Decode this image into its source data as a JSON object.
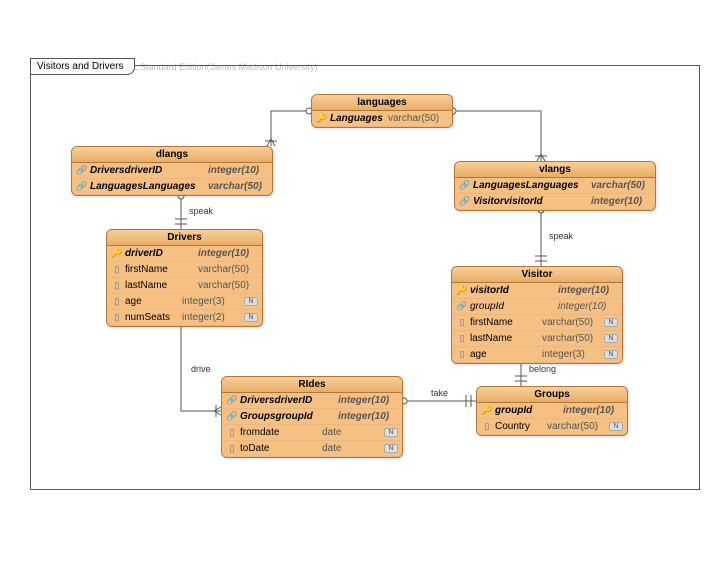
{
  "watermark": "Visual Paradigm for UML Standard Edition(James Madison University)",
  "frame_title": "Visitors and Drivers",
  "entities": {
    "languages": {
      "title": "languages",
      "cols": [
        {
          "icon": "pk",
          "name": "Languages",
          "type": "varchar(50)",
          "nullable": false
        }
      ]
    },
    "dlangs": {
      "title": "dlangs",
      "cols": [
        {
          "icon": "fk",
          "name": "DriversdriverID",
          "type": "integer(10)",
          "nullable": false,
          "bold": true
        },
        {
          "icon": "fk",
          "name": "LanguagesLanguages",
          "type": "varchar(50)",
          "nullable": false,
          "bold": true
        }
      ]
    },
    "vlangs": {
      "title": "vlangs",
      "cols": [
        {
          "icon": "fk",
          "name": "LanguagesLanguages",
          "type": "varchar(50)",
          "nullable": false,
          "bold": true
        },
        {
          "icon": "fk",
          "name": "VisitorvisitorId",
          "type": "integer(10)",
          "nullable": false,
          "bold": true
        }
      ]
    },
    "drivers": {
      "title": "Drivers",
      "cols": [
        {
          "icon": "pk",
          "name": "driverID",
          "type": "integer(10)",
          "nullable": false,
          "bold": true
        },
        {
          "icon": "col",
          "name": "firstName",
          "type": "varchar(50)",
          "nullable": false
        },
        {
          "icon": "col",
          "name": "lastName",
          "type": "varchar(50)",
          "nullable": false
        },
        {
          "icon": "col",
          "name": "age",
          "type": "integer(3)",
          "nullable": true
        },
        {
          "icon": "col",
          "name": "numSeats",
          "type": "integer(2)",
          "nullable": true
        }
      ]
    },
    "visitor": {
      "title": "Visitor",
      "cols": [
        {
          "icon": "pk",
          "name": "visitorId",
          "type": "integer(10)",
          "nullable": false,
          "bold": true
        },
        {
          "icon": "fk",
          "name": "groupId",
          "type": "integer(10)",
          "nullable": false,
          "italic": true
        },
        {
          "icon": "col",
          "name": "firstName",
          "type": "varchar(50)",
          "nullable": true
        },
        {
          "icon": "col",
          "name": "lastName",
          "type": "varchar(50)",
          "nullable": true
        },
        {
          "icon": "col",
          "name": "age",
          "type": "integer(3)",
          "nullable": true
        }
      ]
    },
    "rides": {
      "title": "RIdes",
      "cols": [
        {
          "icon": "fk",
          "name": "DriversdriverID",
          "type": "integer(10)",
          "nullable": false,
          "bold": true
        },
        {
          "icon": "fk",
          "name": "GroupsgroupId",
          "type": "integer(10)",
          "nullable": false,
          "bold": true
        },
        {
          "icon": "col",
          "name": "fromdate",
          "type": "date",
          "nullable": true
        },
        {
          "icon": "col",
          "name": "toDate",
          "type": "date",
          "nullable": true
        }
      ]
    },
    "groups": {
      "title": "Groups",
      "cols": [
        {
          "icon": "pk",
          "name": "groupId",
          "type": "integer(10)",
          "nullable": false,
          "bold": true
        },
        {
          "icon": "col",
          "name": "Country",
          "type": "varchar(50)",
          "nullable": true
        }
      ]
    }
  },
  "relationships": {
    "speak1": "speak",
    "speak2": "speak",
    "drive": "drive",
    "take": "take",
    "belong": "belong"
  }
}
